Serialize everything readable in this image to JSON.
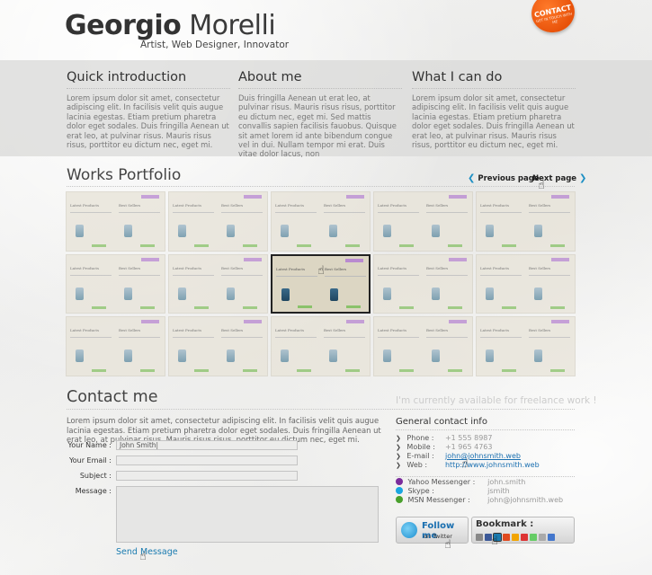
{
  "header": {
    "name_first": "Georgio",
    "name_last": "Morelli",
    "tagline": "Artist, Web Designer, Innovator",
    "contact_badge": "CONTACT",
    "contact_badge_sub": "GET IN TOUCH WITH ME"
  },
  "intro": [
    {
      "title": "Quick introduction",
      "text": "Lorem ipsum dolor sit amet, consectetur adipiscing elit. In facilisis velit quis augue lacinia egestas. Etiam pretium pharetra dolor eget sodales. Duis fringilla Aenean ut erat leo, at pulvinar risus. Mauris risus risus, porttitor eu dictum nec, eget mi."
    },
    {
      "title": "About me",
      "text": "Duis fringilla Aenean ut erat leo, at pulvinar risus. Mauris risus risus, porttitor eu dictum nec, eget mi. Sed mattis convallis sapien facilisis fauobus. Quisque sit amet lorem id ante bibendum congue vel in dui. Nullam tempor mi erat. Duis vitae dolor lacus, non"
    },
    {
      "title": "What I can do",
      "text": "Lorem ipsum dolor sit amet, consectetur adipiscing elit. In facilisis velit quis augue lacinia egestas. Etiam pretium pharetra dolor eget sodales. Duis fringilla Aenean ut erat leo, at pulvinar risus. Mauris risus risus, porttitor eu dictum nec, eget mi."
    }
  ],
  "portfolio": {
    "title": "Works Portfolio",
    "prev_label": "Previous page",
    "next_label": "Next page",
    "thumb_heading_left": "Latest Products",
    "thumb_heading_right": "Best Sellers",
    "thumb_count": 15,
    "active_index": 7
  },
  "contact": {
    "title": "Contact me",
    "freelance_note": "I'm currently available for freelance work !",
    "intro": "Lorem ipsum dolor sit amet, consectetur adipiscing elit. In facilisis velit quis augue lacinia egestas. Etiam pretium pharetra dolor eget sodales. Duis fringilla Aenean ut erat leo, at pulvinar risus. Mauris risus risus, porttitor eu dictum nec, eget mi.",
    "form": {
      "name_label": "Your Name :",
      "name_value": "John Smith|",
      "email_label": "Your Email :",
      "subject_label": "Subject :",
      "message_label": "Message :",
      "send_label": "Send Message"
    },
    "general": {
      "title": "General contact info",
      "phone_label": "Phone :",
      "phone": "+1 555 8987",
      "mobile_label": "Mobile :",
      "mobile": "+1 965 4763",
      "email_label": "E-mail :",
      "email": "john@johnsmith.web",
      "web_label": "Web :",
      "web": "http://www.johnsmith.web"
    },
    "messengers": {
      "yahoo_label": "Yahoo Messenger :",
      "yahoo": "john.smith",
      "skype_label": "Skype :",
      "skype": "jsmith",
      "msn_label": "MSN Messenger :",
      "msn": "john@johnsmith.web"
    },
    "twitter": {
      "line1": "Follow me",
      "line2": "on Twitter"
    },
    "bookmark": {
      "title": "Bookmark :"
    }
  },
  "colors": {
    "accent_link": "#1a7bb0",
    "badge_orange": "#e8520a",
    "thumb_tag": "#b98ad0"
  }
}
